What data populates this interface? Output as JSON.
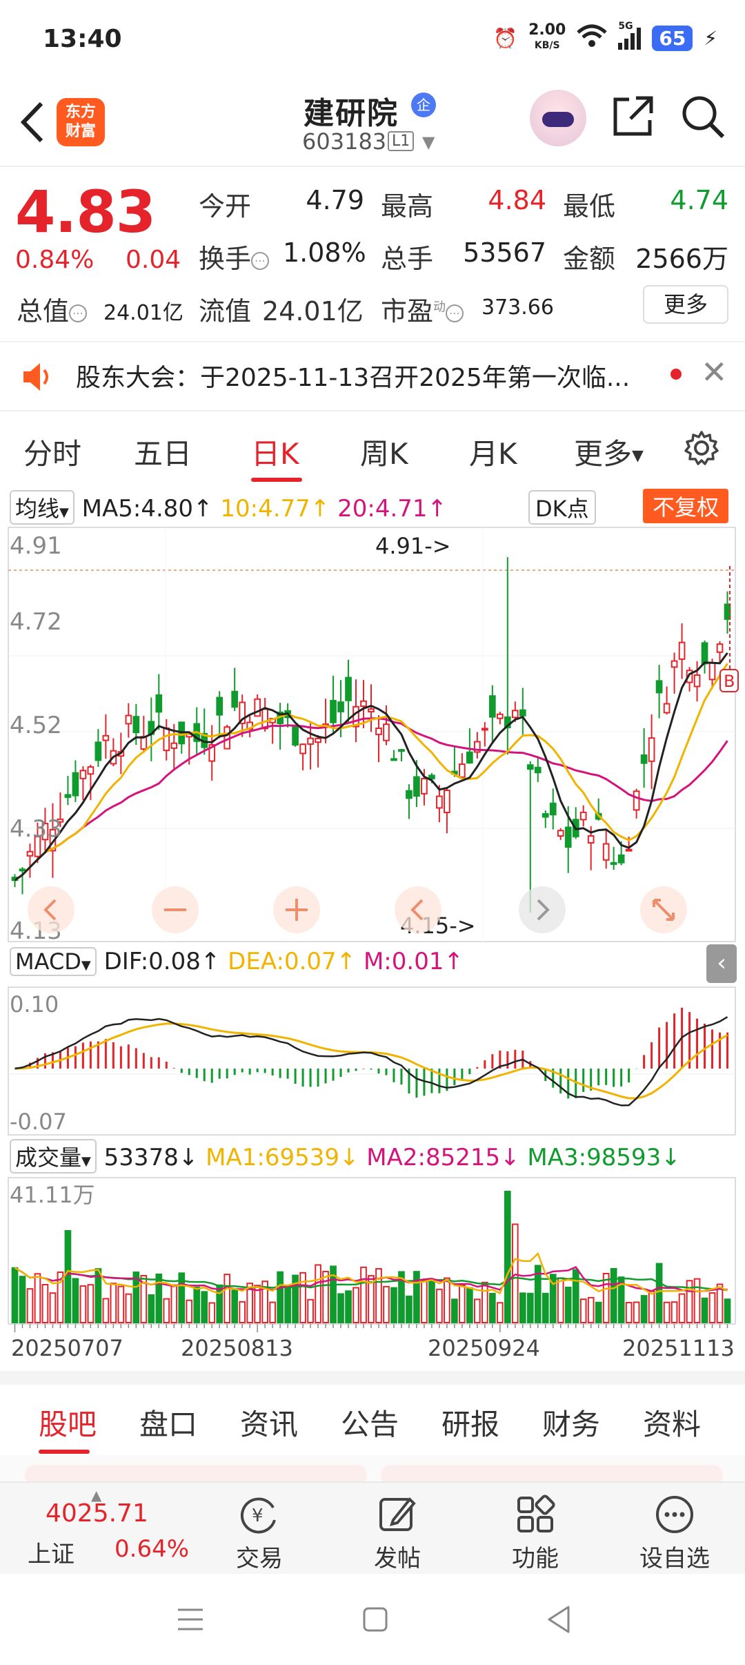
{
  "status_bar": {
    "time": "13:40",
    "speed": "2.00",
    "speed_unit": "KB/S",
    "network": "5G",
    "battery": "65"
  },
  "header": {
    "logo_line1": "东方",
    "logo_line2": "财富",
    "name": "建研院",
    "badge": "企",
    "code": "603183",
    "level": "L1"
  },
  "quote": {
    "price": "4.83",
    "pct": "0.84%",
    "change": "0.04",
    "open_label": "今开",
    "open": "4.79",
    "high_label": "最高",
    "high": "4.84",
    "low_label": "最低",
    "low": "4.74",
    "turnover_label": "换手",
    "turnover": "1.08%",
    "volume_label": "总手",
    "volume": "53567",
    "amount_label": "金额",
    "amount": "2566万",
    "mktcap_label": "总值",
    "mktcap": "24.01亿",
    "float_label": "流值",
    "float": "24.01亿",
    "pe_label": "市盈",
    "pe_sup": "动",
    "pe": "373.66",
    "more_label": "更多"
  },
  "notice": {
    "text": "股东大会：于2025-11-13召开2025年第一次临..."
  },
  "tabs": [
    "分时",
    "五日",
    "日K",
    "周K",
    "月K",
    "更多"
  ],
  "chart": {
    "indicator_label": "均线",
    "ma5": "MA5:4.80↑",
    "ma10": "10:4.77↑",
    "ma20": "20:4.71↑",
    "dk_label": "DK点",
    "fuquan": "不复权",
    "price_ticks": [
      "4.91",
      "4.72",
      "4.52",
      "4.33",
      "4.13"
    ],
    "max_annot": "4.91->",
    "min_annot": "4.15->",
    "macd_label": "MACD",
    "dif": "DIF:0.08↑",
    "dea": "DEA:0.07↑",
    "m": "M:0.01↑",
    "macd_ticks": [
      "0.10",
      "-0.07"
    ],
    "vol_label": "成交量",
    "vol": "53378↓",
    "vol_ma1": "MA1:69539↓",
    "vol_ma2": "MA2:85215↓",
    "vol_ma3": "MA3:98593↓",
    "vol_tick": "41.11万",
    "dates": [
      "20250707",
      "20250813",
      "20250924",
      "20251113"
    ],
    "b_marker": "B",
    "colors": {
      "up": "#e4242a",
      "down": "#0f9b2d",
      "ma5": "#222222",
      "ma10": "#f0b400",
      "ma20": "#d4147c"
    }
  },
  "bottom_tabs": [
    "股吧",
    "盘口",
    "资讯",
    "公告",
    "研报",
    "财务",
    "资料"
  ],
  "bottom_bar": {
    "index_value": "4025.71",
    "index_name": "上证",
    "index_pct": "0.64%",
    "items": [
      "交易",
      "发帖",
      "功能",
      "设自选"
    ]
  }
}
